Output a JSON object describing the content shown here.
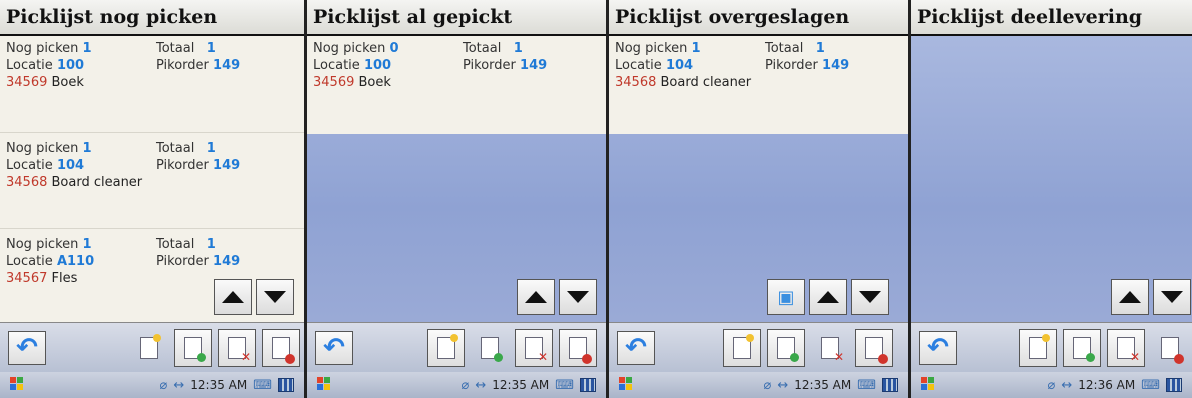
{
  "screens": [
    {
      "title": "Picklijst nog picken",
      "items": [
        {
          "nog_label": "Nog picken",
          "nog_value": "1",
          "totaal_label": "Totaal",
          "totaal_value": "1",
          "locatie_label": "Locatie",
          "locatie_value": "100",
          "pikorder_label": "Pikorder",
          "pikorder_value": "149",
          "code": "34569",
          "name": "Boek"
        },
        {
          "nog_label": "Nog picken",
          "nog_value": "1",
          "totaal_label": "Totaal",
          "totaal_value": "1",
          "locatie_label": "Locatie",
          "locatie_value": "104",
          "pikorder_label": "Pikorder",
          "pikorder_value": "149",
          "code": "34568",
          "name": "Board cleaner"
        },
        {
          "nog_label": "Nog picken",
          "nog_value": "1",
          "totaal_label": "Totaal",
          "totaal_value": "1",
          "locatie_label": "Locatie",
          "locatie_value": "A110",
          "pikorder_label": "Pikorder",
          "pikorder_value": "149",
          "code": "34567",
          "name": "Fles"
        }
      ],
      "time": "12:35 AM"
    },
    {
      "title": "Picklijst al gepickt",
      "items": [
        {
          "nog_label": "Nog picken",
          "nog_value": "0",
          "totaal_label": "Totaal",
          "totaal_value": "1",
          "locatie_label": "Locatie",
          "locatie_value": "100",
          "pikorder_label": "Pikorder",
          "pikorder_value": "149",
          "code": "34569",
          "name": "Boek"
        }
      ],
      "time": "12:35 AM"
    },
    {
      "title": "Picklijst overgeslagen",
      "items": [
        {
          "nog_label": "Nog picken",
          "nog_value": "1",
          "totaal_label": "Totaal",
          "totaal_value": "1",
          "locatie_label": "Locatie",
          "locatie_value": "104",
          "pikorder_label": "Pikorder",
          "pikorder_value": "149",
          "code": "34568",
          "name": "Board cleaner"
        }
      ],
      "time": "12:35 AM"
    },
    {
      "title": "Picklijst deellevering",
      "items": [],
      "time": "12:36 AM"
    }
  ],
  "icons": {
    "undo": "undo-arrow-icon",
    "new": "new-document-icon",
    "confirm": "document-confirm-icon",
    "skip": "document-skip-icon",
    "cancel": "document-cancel-icon",
    "scan": "scan-icon",
    "up": "arrow-up-icon",
    "down": "arrow-down-icon",
    "start": "windows-start-icon"
  },
  "colors": {
    "accent": "#1f7ad6",
    "code": "#c0392b",
    "title_bar": "#e8e8e4",
    "list_bg": "#f3f1e9",
    "empty_bg": "#9aaad6"
  }
}
